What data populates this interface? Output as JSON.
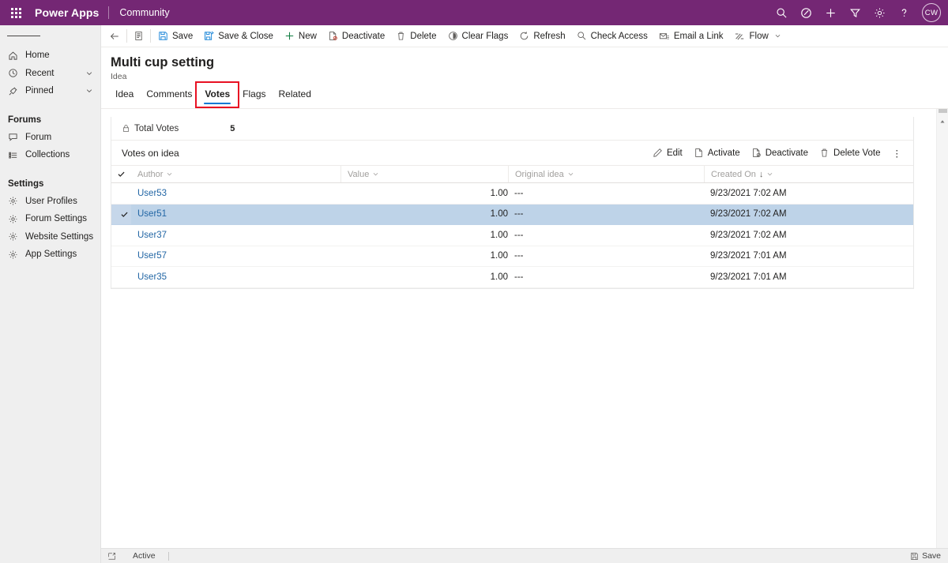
{
  "appbar": {
    "waffle": "app-launcher",
    "brand": "Power Apps",
    "app_name": "Community",
    "icons": [
      "search-icon",
      "check-circle-icon",
      "plus-icon",
      "filter-icon",
      "gear-icon",
      "help-icon"
    ],
    "avatar_initials": "CW",
    "bg_color": "#742774"
  },
  "commandbar": {
    "back_label": "Back",
    "form_label": "Form selector",
    "items": [
      {
        "label": "Save",
        "icon": "save-icon"
      },
      {
        "label": "Save & Close",
        "icon": "save-close-icon"
      },
      {
        "label": "New",
        "icon": "plus-icon"
      },
      {
        "label": "Deactivate",
        "icon": "deactivate-icon"
      },
      {
        "label": "Delete",
        "icon": "trash-icon"
      },
      {
        "label": "Clear Flags",
        "icon": "clear-flags-icon"
      },
      {
        "label": "Refresh",
        "icon": "refresh-icon"
      },
      {
        "label": "Check Access",
        "icon": "check-access-icon"
      },
      {
        "label": "Email a Link",
        "icon": "email-link-icon"
      },
      {
        "label": "Flow",
        "icon": "flow-icon"
      }
    ]
  },
  "sidebar": {
    "hamburger": "site-map-toggle",
    "groups": [
      {
        "header": "",
        "items": [
          {
            "label": "Home",
            "icon": "home-icon",
            "chevron": false
          },
          {
            "label": "Recent",
            "icon": "clock-icon",
            "chevron": true
          },
          {
            "label": "Pinned",
            "icon": "pin-icon",
            "chevron": true
          }
        ]
      },
      {
        "header": "Forums",
        "items": [
          {
            "label": "Forum",
            "icon": "comment-icon",
            "chevron": false
          },
          {
            "label": "Collections",
            "icon": "list-icon",
            "chevron": false
          }
        ]
      },
      {
        "header": "Settings",
        "items": [
          {
            "label": "User Profiles",
            "icon": "gear-icon",
            "chevron": false
          },
          {
            "label": "Forum Settings",
            "icon": "gear-icon",
            "chevron": false
          },
          {
            "label": "Website Settings",
            "icon": "gear-icon",
            "chevron": false
          },
          {
            "label": "App Settings",
            "icon": "gear-icon",
            "chevron": false
          }
        ]
      }
    ]
  },
  "record": {
    "title": "Multi cup setting",
    "entity": "Idea"
  },
  "tabs": {
    "items": [
      "Idea",
      "Comments",
      "Votes",
      "Flags",
      "Related"
    ],
    "selected": "Votes",
    "annotation_color": "#e81123",
    "underline_color": "#0078d4"
  },
  "total_votes": {
    "label": "Total Votes",
    "value": "5",
    "icon": "lock-icon"
  },
  "subgrid": {
    "title": "Votes on idea",
    "commands": [
      {
        "label": "Edit",
        "icon": "pencil-icon"
      },
      {
        "label": "Activate",
        "icon": "activate-icon"
      },
      {
        "label": "Deactivate",
        "icon": "deactivate-icon"
      },
      {
        "label": "Delete Vote",
        "icon": "trash-icon"
      }
    ],
    "overflow": "⋮",
    "columns": [
      {
        "label": "Author",
        "sorted": false
      },
      {
        "label": "Value",
        "sorted": false
      },
      {
        "label": "Original idea",
        "sorted": false
      },
      {
        "label": "Created On",
        "sorted": true,
        "sort_dir": "↓"
      }
    ],
    "rows": [
      {
        "author": "User53",
        "value": "1.00",
        "original_idea": "---",
        "created_on": "9/23/2021 7:02 AM",
        "selected": false
      },
      {
        "author": "User51",
        "value": "1.00",
        "original_idea": "---",
        "created_on": "9/23/2021 7:02 AM",
        "selected": true
      },
      {
        "author": "User37",
        "value": "1.00",
        "original_idea": "---",
        "created_on": "9/23/2021 7:02 AM",
        "selected": false
      },
      {
        "author": "User57",
        "value": "1.00",
        "original_idea": "---",
        "created_on": "9/23/2021 7:01 AM",
        "selected": false
      },
      {
        "author": "User35",
        "value": "1.00",
        "original_idea": "---",
        "created_on": "9/23/2021 7:01 AM",
        "selected": false
      }
    ],
    "selected_row_color": "#bed3e8"
  },
  "statusbar": {
    "state_icon": "record-state-icon",
    "state": "Active",
    "save_label": "Save",
    "save_icon": "save-icon"
  }
}
